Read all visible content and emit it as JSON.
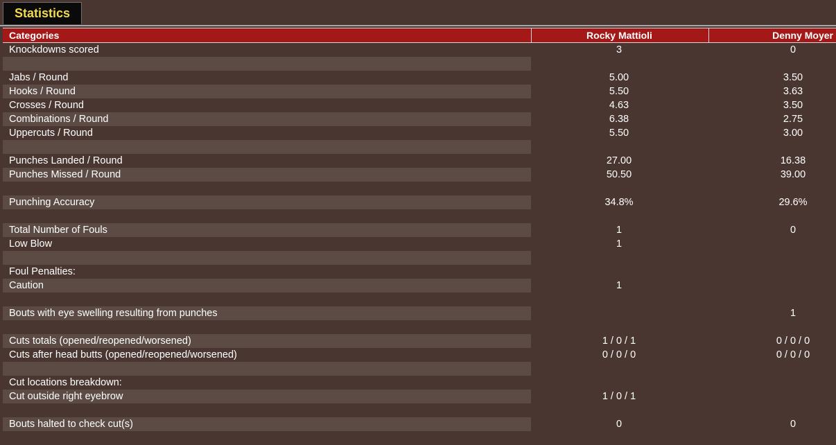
{
  "tab": {
    "label": "Statistics"
  },
  "header": {
    "categories": "Categories",
    "fighter1": "Rocky Mattioli",
    "fighter2": "Denny Moyer"
  },
  "rows": [
    {
      "label": "Knockdowns scored",
      "f1": "3",
      "f2": "0"
    },
    {
      "label": "",
      "f1": "",
      "f2": ""
    },
    {
      "label": "Jabs / Round",
      "f1": "5.00",
      "f2": "3.50"
    },
    {
      "label": "Hooks / Round",
      "f1": "5.50",
      "f2": "3.63"
    },
    {
      "label": "Crosses / Round",
      "f1": "4.63",
      "f2": "3.50"
    },
    {
      "label": "Combinations / Round",
      "f1": "6.38",
      "f2": "2.75"
    },
    {
      "label": "Uppercuts / Round",
      "f1": "5.50",
      "f2": "3.00"
    },
    {
      "label": "",
      "f1": "",
      "f2": ""
    },
    {
      "label": "Punches Landed / Round",
      "f1": "27.00",
      "f2": "16.38"
    },
    {
      "label": "Punches Missed / Round",
      "f1": "50.50",
      "f2": "39.00"
    },
    {
      "label": "",
      "f1": "",
      "f2": ""
    },
    {
      "label": "Punching Accuracy",
      "f1": "34.8%",
      "f2": "29.6%"
    },
    {
      "label": "",
      "f1": "",
      "f2": ""
    },
    {
      "label": "Total Number of Fouls",
      "f1": "1",
      "f2": "0"
    },
    {
      "label": "Low Blow",
      "f1": "1",
      "f2": ""
    },
    {
      "label": "",
      "f1": "",
      "f2": ""
    },
    {
      "label": "Foul Penalties:",
      "f1": "",
      "f2": ""
    },
    {
      "label": "Caution",
      "f1": "1",
      "f2": ""
    },
    {
      "label": "",
      "f1": "",
      "f2": ""
    },
    {
      "label": "Bouts with eye swelling resulting from punches",
      "f1": "",
      "f2": "1"
    },
    {
      "label": "",
      "f1": "",
      "f2": ""
    },
    {
      "label": "Cuts totals (opened/reopened/worsened)",
      "f1": "1 / 0 / 1",
      "f2": "0 / 0 / 0"
    },
    {
      "label": "Cuts after head butts (opened/reopened/worsened)",
      "f1": "0 / 0 / 0",
      "f2": "0 / 0 / 0"
    },
    {
      "label": "",
      "f1": "",
      "f2": ""
    },
    {
      "label": "Cut locations breakdown:",
      "f1": "",
      "f2": ""
    },
    {
      "label": "Cut outside right eyebrow",
      "f1": "1 / 0 / 1",
      "f2": ""
    },
    {
      "label": "",
      "f1": "",
      "f2": ""
    },
    {
      "label": "Bouts halted to check cut(s)",
      "f1": "0",
      "f2": "0"
    },
    {
      "label": "",
      "f1": "",
      "f2": ""
    }
  ]
}
